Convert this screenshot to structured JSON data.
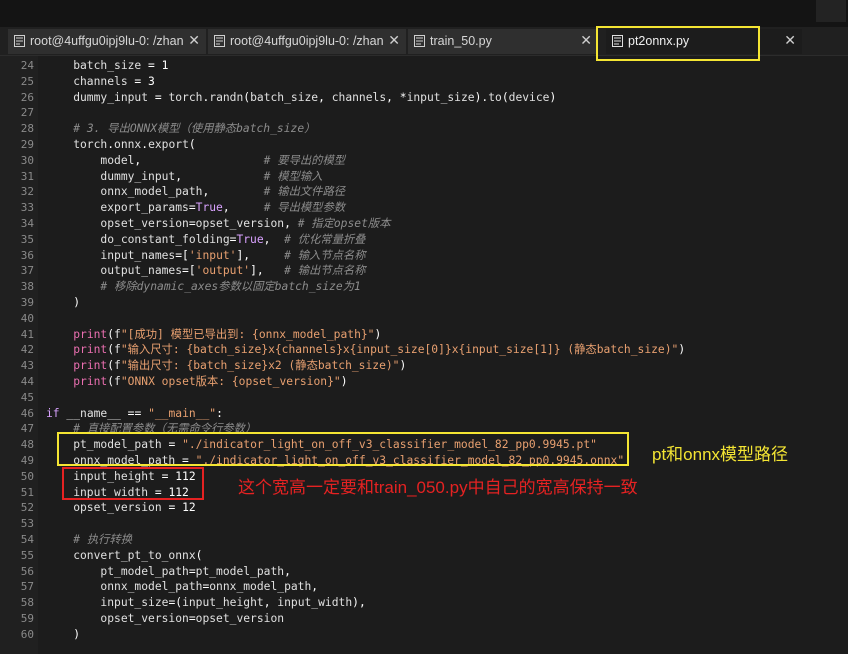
{
  "tabs": [
    {
      "label": "root@4uffgu0ipj9lu-0: /zhan",
      "close": "✕",
      "icon": "terminal-icon"
    },
    {
      "label": "root@4uffgu0ipj9lu-0: /zhan",
      "close": "✕",
      "icon": "terminal-icon"
    },
    {
      "label": "train_50.py",
      "close": "✕",
      "icon": "file-icon"
    },
    {
      "label": "pt2onnx.py",
      "close": "✕",
      "icon": "file-icon",
      "active": true
    }
  ],
  "annotations": {
    "paths": "pt和onnx模型路径",
    "size": "这个宽高一定要和train_050.py中自己的宽高保持一致"
  },
  "lines": [
    {
      "n": "24",
      "c": "    batch_size = 1"
    },
    {
      "n": "25",
      "c": "    channels = 3"
    },
    {
      "n": "26",
      "c": "    dummy_input = torch.randn(batch_size, channels, *input_size).to(device)"
    },
    {
      "n": "27",
      "c": ""
    },
    {
      "n": "28",
      "c": "    # 3. 导出ONNX模型（使用静态batch_size）"
    },
    {
      "n": "29",
      "c": "    torch.onnx.export("
    },
    {
      "n": "30",
      "c": "        model,                  # 要导出的模型"
    },
    {
      "n": "31",
      "c": "        dummy_input,            # 模型输入"
    },
    {
      "n": "32",
      "c": "        onnx_model_path,        # 输出文件路径"
    },
    {
      "n": "33",
      "c": "        export_params=True,     # 导出模型参数"
    },
    {
      "n": "34",
      "c": "        opset_version=opset_version, # 指定opset版本"
    },
    {
      "n": "35",
      "c": "        do_constant_folding=True,  # 优化常量折叠"
    },
    {
      "n": "36",
      "c": "        input_names=['input'],     # 输入节点名称"
    },
    {
      "n": "37",
      "c": "        output_names=['output'],   # 输出节点名称"
    },
    {
      "n": "38",
      "c": "        # 移除dynamic_axes参数以固定batch_size为1"
    },
    {
      "n": "39",
      "c": "    )"
    },
    {
      "n": "40",
      "c": ""
    },
    {
      "n": "41",
      "c": "    print(f\"[成功] 模型已导出到: {onnx_model_path}\")"
    },
    {
      "n": "42",
      "c": "    print(f\"输入尺寸: {batch_size}x{channels}x{input_size[0]}x{input_size[1]} (静态batch_size)\")"
    },
    {
      "n": "43",
      "c": "    print(f\"输出尺寸: {batch_size}x2 (静态batch_size)\")"
    },
    {
      "n": "44",
      "c": "    print(f\"ONNX opset版本: {opset_version}\")"
    },
    {
      "n": "45",
      "c": ""
    },
    {
      "n": "46",
      "c": "if __name__ == \"__main__\":"
    },
    {
      "n": "47",
      "c": "    # 直接配置参数（无需命令行参数）"
    },
    {
      "n": "48",
      "c": "    pt_model_path = \"./indicator_light_on_off_v3_classifier_model_82_pp0.9945.pt\""
    },
    {
      "n": "49",
      "c": "    onnx_model_path = \"./indicator_light_on_off_v3_classifier_model_82_pp0.9945.onnx\""
    },
    {
      "n": "50",
      "c": "    input_height = 112"
    },
    {
      "n": "51",
      "c": "    input_width = 112"
    },
    {
      "n": "52",
      "c": "    opset_version = 12"
    },
    {
      "n": "53",
      "c": ""
    },
    {
      "n": "54",
      "c": "    # 执行转换"
    },
    {
      "n": "55",
      "c": "    convert_pt_to_onnx("
    },
    {
      "n": "56",
      "c": "        pt_model_path=pt_model_path,"
    },
    {
      "n": "57",
      "c": "        onnx_model_path=onnx_model_path,"
    },
    {
      "n": "58",
      "c": "        input_size=(input_height, input_width),"
    },
    {
      "n": "59",
      "c": "        opset_version=opset_version"
    },
    {
      "n": "60",
      "c": "    )"
    }
  ]
}
